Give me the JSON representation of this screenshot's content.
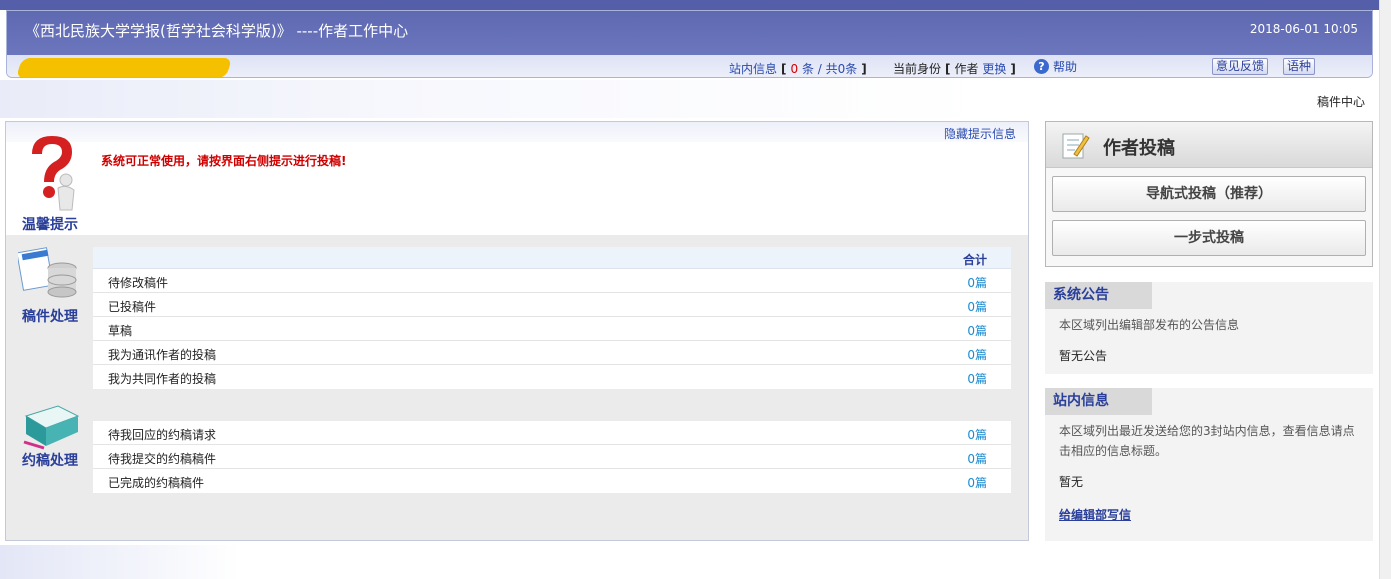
{
  "header": {
    "title": "《西北民族大学学报(哲学社会科学版)》 ----作者工作中心",
    "datetime": "2018-06-01 10:05",
    "mail_label": "站内信息",
    "mail_unread": "0",
    "mail_sep": "条 / 共",
    "mail_total": "0条",
    "identity_label": "当前身份",
    "identity_role": "作者",
    "identity_switch": "更换",
    "help_label": "帮助",
    "feedback_button": "意见反馈",
    "language_button": "语种",
    "redacted_name_color": "#f5c000"
  },
  "breadcrumb": "稿件中心",
  "tips": {
    "hide_link": "隐藏提示信息",
    "message": "系统可正常使用，请按界面右侧提示进行投稿!",
    "section_label": "温馨提示"
  },
  "manuscripts": {
    "section_label": "稿件处理",
    "total_header": "合计",
    "rows": [
      {
        "label": "待修改稿件",
        "count": "0篇"
      },
      {
        "label": "已投稿件",
        "count": "0篇"
      },
      {
        "label": "草稿",
        "count": "0篇"
      },
      {
        "label": "我为通讯作者的投稿",
        "count": "0篇"
      },
      {
        "label": "我为共同作者的投稿",
        "count": "0篇"
      }
    ]
  },
  "invitations": {
    "section_label": "约稿处理",
    "rows": [
      {
        "label": "待我回应的约稿请求",
        "count": "0篇"
      },
      {
        "label": "待我提交的约稿稿件",
        "count": "0篇"
      },
      {
        "label": "已完成的约稿稿件",
        "count": "0篇"
      }
    ]
  },
  "submit": {
    "title": "作者投稿",
    "guided_button": "导航式投稿（推荐）",
    "onestep_button": "一步式投稿"
  },
  "announcements": {
    "title": "系统公告",
    "desc": "本区域列出编辑部发布的公告信息",
    "content": "暂无公告"
  },
  "messages": {
    "title": "站内信息",
    "desc": "本区域列出最近发送给您的3封站内信息，查看信息请点击相应的信息标题。",
    "content": "暂无",
    "write_link": "给编辑部写信"
  }
}
